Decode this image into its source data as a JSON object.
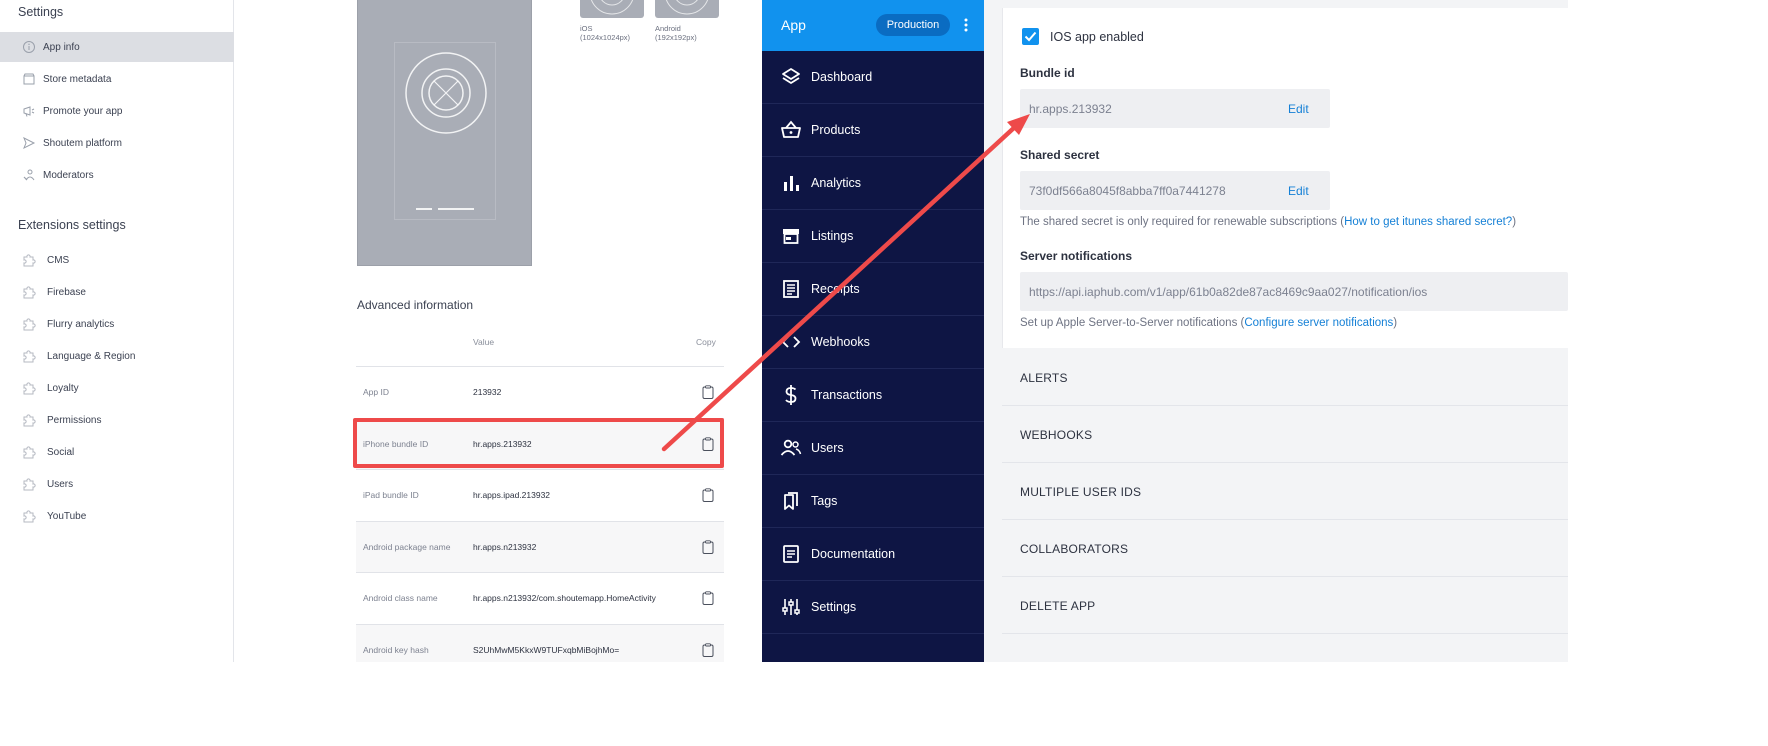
{
  "settings": {
    "heading": "Settings",
    "items": [
      {
        "label": "App info",
        "icon": "info-circle-icon",
        "active": true
      },
      {
        "label": "Store metadata",
        "icon": "store-icon"
      },
      {
        "label": "Promote your app",
        "icon": "megaphone-icon"
      },
      {
        "label": "Shoutem platform",
        "icon": "paper-plane-icon"
      },
      {
        "label": "Moderators",
        "icon": "user-wrench-icon"
      }
    ],
    "extensions_heading": "Extensions settings",
    "extensions": [
      {
        "label": "CMS",
        "icon": "puzzle-icon"
      },
      {
        "label": "Firebase",
        "icon": "puzzle-icon"
      },
      {
        "label": "Flurry analytics",
        "icon": "puzzle-icon"
      },
      {
        "label": "Language & Region",
        "icon": "puzzle-icon"
      },
      {
        "label": "Loyalty",
        "icon": "puzzle-icon"
      },
      {
        "label": "Permissions",
        "icon": "puzzle-icon"
      },
      {
        "label": "Social",
        "icon": "puzzle-icon"
      },
      {
        "label": "Users",
        "icon": "puzzle-icon"
      },
      {
        "label": "YouTube",
        "icon": "puzzle-icon"
      }
    ]
  },
  "appinfo": {
    "icon_sizes": [
      {
        "platform": "iOS",
        "size": "(1024x1024px)"
      },
      {
        "platform": "Android",
        "size": "(192x192px)"
      }
    ],
    "advanced_title": "Advanced information",
    "col_value": "Value",
    "col_copy": "Copy",
    "rows": [
      {
        "key": "App ID",
        "value": "213932"
      },
      {
        "key": "iPhone bundle ID",
        "value": "hr.apps.213932"
      },
      {
        "key": "iPad bundle ID",
        "value": "hr.apps.ipad.213932"
      },
      {
        "key": "Android package name",
        "value": "hr.apps.n213932"
      },
      {
        "key": "Android class name",
        "value": "hr.apps.n213932/com.shoutemapp.HomeActivity"
      },
      {
        "key": "Android key hash",
        "value": "S2UhMwM5KkxW9TUFxqbMiBojhMo="
      }
    ]
  },
  "nav": {
    "app_title": "App",
    "environment": "Production",
    "items": [
      {
        "label": "Dashboard",
        "icon": "layers-icon"
      },
      {
        "label": "Products",
        "icon": "basket-icon"
      },
      {
        "label": "Analytics",
        "icon": "bar-chart-icon"
      },
      {
        "label": "Listings",
        "icon": "storefront-icon"
      },
      {
        "label": "Receipts",
        "icon": "receipt-icon"
      },
      {
        "label": "Webhooks",
        "icon": "code-icon"
      },
      {
        "label": "Transactions",
        "icon": "dollar-icon"
      },
      {
        "label": "Users",
        "icon": "people-icon"
      },
      {
        "label": "Tags",
        "icon": "bookmarks-icon"
      },
      {
        "label": "Documentation",
        "icon": "document-icon"
      },
      {
        "label": "Settings",
        "icon": "sliders-icon"
      }
    ]
  },
  "ios": {
    "enabled_label": "IOS app enabled",
    "enabled": true,
    "bundle_label": "Bundle id",
    "bundle_value": "hr.apps.213932",
    "edit_label": "Edit",
    "secret_label": "Shared secret",
    "secret_value": "73f0df566a8045f8abba7ff0a7441278",
    "secret_help_prefix": "The shared secret is only required for renewable subscriptions (",
    "secret_help_link": "How to get itunes shared secret?",
    "secret_help_suffix": ")",
    "notif_label": "Server notifications",
    "notif_url": "https://api.iaphub.com/v1/app/61b0a82de87ac8469c9aa027/notification/ios",
    "notif_help_prefix": "Set up Apple Server-to-Server notifications (",
    "notif_help_link": "Configure server notifications",
    "notif_help_suffix": ")"
  },
  "sections": [
    "ALERTS",
    "WEBHOOKS",
    "MULTIPLE USER IDS",
    "COLLABORATORS",
    "DELETE APP"
  ],
  "colors": {
    "accent_blue": "#1192ee",
    "nav_dark": "#0e1544",
    "annotation_red": "#ee4a4a",
    "link_blue": "#1580d6"
  }
}
